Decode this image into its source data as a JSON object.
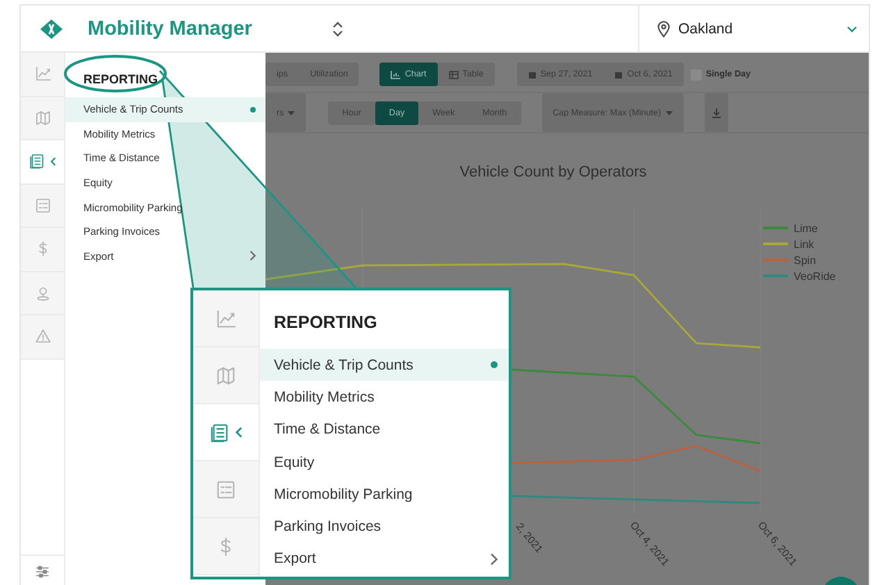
{
  "header": {
    "title": "Mobility Manager",
    "location": "Oakland"
  },
  "rail": [
    {
      "kind": "chart",
      "selected": false
    },
    {
      "kind": "map",
      "selected": false
    },
    {
      "kind": "reports",
      "selected": true
    },
    {
      "kind": "list",
      "selected": false
    },
    {
      "kind": "dollar",
      "selected": false
    },
    {
      "kind": "user",
      "selected": false
    },
    {
      "kind": "alert",
      "selected": false
    }
  ],
  "rail_footer": {
    "kind": "sliders"
  },
  "menu": {
    "heading": "REPORTING",
    "items": [
      {
        "label": "Vehicle & Trip Counts",
        "selected": true,
        "submenu": false
      },
      {
        "label": "Mobility Metrics",
        "selected": false,
        "submenu": false
      },
      {
        "label": "Time & Distance",
        "selected": false,
        "submenu": false
      },
      {
        "label": "Equity",
        "selected": false,
        "submenu": false
      },
      {
        "label": "Micromobility Parking",
        "selected": false,
        "submenu": false
      },
      {
        "label": "Parking Invoices",
        "selected": false,
        "submenu": false
      },
      {
        "label": "Export",
        "selected": false,
        "submenu": true
      }
    ]
  },
  "toolbar": {
    "view_tabs": [
      {
        "label": "ips"
      },
      {
        "label": "Utilization"
      }
    ],
    "display_tabs": [
      {
        "label": "Chart",
        "kind": "chart",
        "selected": true
      },
      {
        "label": "Table",
        "kind": "table",
        "selected": false
      }
    ],
    "date_range": {
      "start": "Sep 27, 2021",
      "end": "Oct 6, 2021"
    },
    "single_day": {
      "label": "Single Day",
      "checked": false
    },
    "group_select": {
      "value": "rs"
    },
    "interval_tabs": [
      {
        "label": "Hour",
        "selected": false
      },
      {
        "label": "Day",
        "selected": true
      },
      {
        "label": "Week",
        "selected": false
      },
      {
        "label": "Month",
        "selected": false
      }
    ],
    "cap_measure": {
      "label": "Cap Measure:",
      "value": "Max (Minute)"
    }
  },
  "chart": {
    "title": "Vehicle Count by Operators",
    "legend": [
      {
        "name": "Lime",
        "color": "#3b8a3b"
      },
      {
        "name": "Link",
        "color": "#a8a83a"
      },
      {
        "name": "Spin",
        "color": "#b8623e"
      },
      {
        "name": "VeoRide",
        "color": "#2e8a80"
      }
    ],
    "x_labels": [
      "2, 2021",
      "Oct 4, 2021",
      "Oct 6, 2021"
    ]
  },
  "callout": {
    "rail": [
      {
        "kind": "chart",
        "selected": false
      },
      {
        "kind": "map",
        "selected": false
      },
      {
        "kind": "reports",
        "selected": true
      },
      {
        "kind": "list",
        "selected": false
      },
      {
        "kind": "dollar",
        "selected": false
      }
    ],
    "heading": "REPORTING",
    "items": [
      {
        "label": "Vehicle & Trip Counts",
        "selected": true,
        "submenu": false
      },
      {
        "label": "Mobility Metrics",
        "selected": false,
        "submenu": false
      },
      {
        "label": "Time & Distance",
        "selected": false,
        "submenu": false
      },
      {
        "label": "Equity",
        "selected": false,
        "submenu": false
      },
      {
        "label": "Micromobility Parking",
        "selected": false,
        "submenu": false
      },
      {
        "label": "Parking Invoices",
        "selected": false,
        "submenu": false
      },
      {
        "label": "Export",
        "selected": false,
        "submenu": true
      }
    ]
  }
}
